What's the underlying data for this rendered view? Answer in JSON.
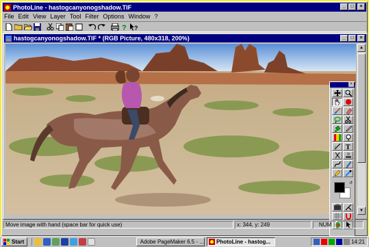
{
  "window": {
    "title": "PhotoLine - hastogcanyonogshadow.TIF",
    "controls": [
      "_",
      "□",
      "×"
    ]
  },
  "menu": {
    "items": [
      "File",
      "Edit",
      "View",
      "Layer",
      "Tool",
      "Filter",
      "Options",
      "Window",
      "?"
    ]
  },
  "toolbar": {
    "buttons": [
      "new-icon",
      "open-icon",
      "open-folder-icon",
      "save-icon",
      "cut-icon",
      "copy-icon",
      "paste-icon",
      "clear-icon",
      "undo-icon",
      "redo-icon",
      "print-icon",
      "help-icon",
      "context-help-icon"
    ]
  },
  "document": {
    "title": "hastogcanyonogshadow.TIF * (RGB Picture, 480x318, 200%)",
    "controls": [
      "_",
      "□",
      "×"
    ]
  },
  "palette": {
    "tools": [
      "hand-icon",
      "zoom-icon",
      "move-icon",
      "ellipse-icon",
      "brush-icon",
      "eraser-icon",
      "lasso-icon",
      "scissors-icon",
      "fill-icon",
      "eyedropper-icon",
      "gradient-icon",
      "smudge-icon",
      "line-icon",
      "text-icon",
      "clone-icon",
      "stamp-icon",
      "curve-icon",
      "sharpen-icon",
      "pencil-icon",
      "airbrush-icon"
    ],
    "bottom_tools": [
      "layer-icon",
      "mask-icon",
      "grid-icon",
      "magnet-icon",
      "quickmask-icon",
      "pointer-icon"
    ],
    "colors": {
      "foreground": "#000000",
      "background": "#ffffff"
    }
  },
  "statusbar": {
    "message": "Move image with hand (space bar for quick use)",
    "coords": "x: 344, y: 249",
    "numlock": "NUM"
  },
  "taskbar": {
    "start": "Start",
    "tasks": [
      {
        "label": "Adobe PageMaker 6.5 - ...",
        "active": false
      },
      {
        "label": "PhotoLine - hastog...",
        "active": true
      }
    ],
    "clock": "14:21"
  }
}
